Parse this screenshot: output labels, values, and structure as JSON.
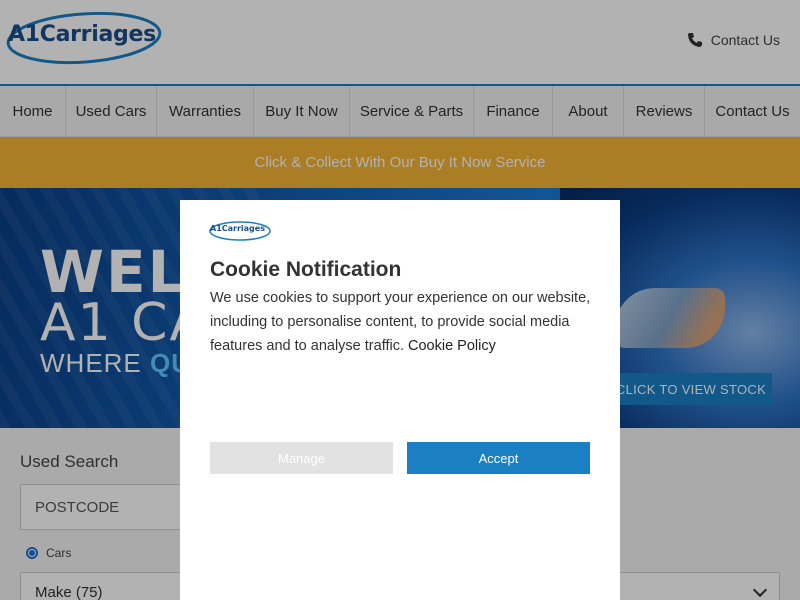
{
  "header": {
    "logo_text": "A1Carriages",
    "contact_label": "Contact Us"
  },
  "nav": {
    "items": [
      {
        "label": "Home"
      },
      {
        "label": "Used Cars"
      },
      {
        "label": "Warranties"
      },
      {
        "label": "Buy It Now"
      },
      {
        "label": "Service & Parts"
      },
      {
        "label": "Finance"
      },
      {
        "label": "About"
      },
      {
        "label": "Reviews"
      },
      {
        "label": "Contact Us"
      }
    ]
  },
  "promo": {
    "text": "Click & Collect With Our Buy It Now Service"
  },
  "hero": {
    "welcome": "WELC",
    "name": "A1 CA",
    "where": "WHERE ",
    "where_highlight": "QU",
    "stock_button": "CLICK TO VIEW STOCK"
  },
  "search": {
    "title": "Used Search",
    "postcode_placeholder": "POSTCODE",
    "radio_label": "Cars",
    "make_label": "Make (75)"
  },
  "cookie": {
    "logo_text": "A1Carriages",
    "title": "Cookie Notification",
    "body": "We use cookies to support your experience on our website, including to personalise content, to provide social media features and to analyse traffic. ",
    "policy_link": "Cookie Policy",
    "manage_label": "Manage",
    "accept_label": "Accept"
  },
  "colors": {
    "brand_blue": "#1b7fc4",
    "promo_amber": "#f5b335",
    "logo_navy": "#1a4e8a"
  }
}
